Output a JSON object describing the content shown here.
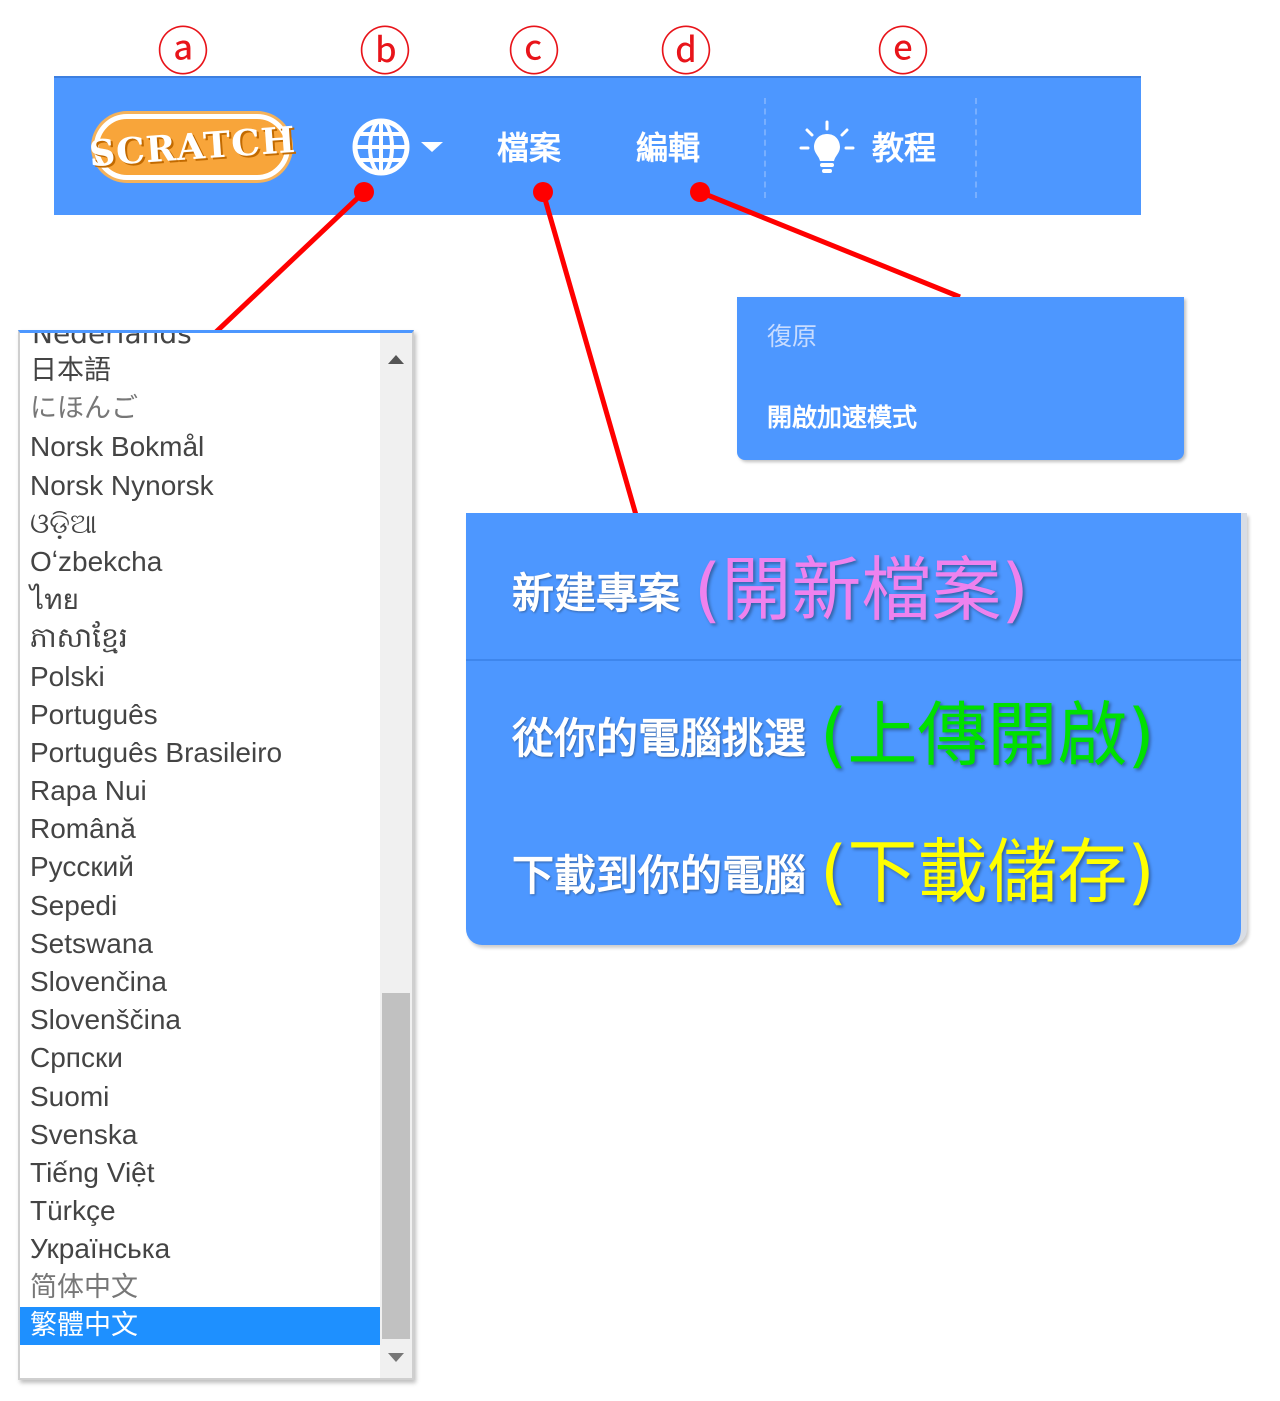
{
  "markers": [
    "ⓐ",
    "ⓑ",
    "ⓒ",
    "ⓓ",
    "ⓔ"
  ],
  "menubar": {
    "logo_text": "SCRATCH",
    "file_label": "檔案",
    "edit_label": "編輯",
    "tutorials_label": "教程",
    "language_icon": "globe-icon",
    "tutorials_icon": "lightbulb-icon"
  },
  "language_menu": {
    "partial_top": "Nederlands",
    "items": [
      "日本語",
      "にほんご",
      "Norsk Bokmål",
      "Norsk Nynorsk",
      "ଓଡ଼ିଆ",
      "Oʻzbekcha",
      "ไทย",
      "ភាសាខ្មែរ",
      "Polski",
      "Português",
      "Português Brasileiro",
      "Rapa Nui",
      "Română",
      "Русский",
      "Sepedi",
      "Setswana",
      "Slovenčina",
      "Slovenščina",
      "Српски",
      "Suomi",
      "Svenska",
      "Tiếng Việt",
      "Türkçe",
      "Українська",
      "简体中文",
      "繁體中文"
    ],
    "selected": "繁體中文"
  },
  "edit_menu": {
    "undo": "復原",
    "turbo_mode": "開啟加速模式"
  },
  "file_menu": {
    "items": [
      {
        "label": "新建專案",
        "note": "(開新檔案)",
        "note_color": "#ee82ee"
      },
      {
        "label": "從你的電腦挑選",
        "note": "(上傳開啟)",
        "note_color": "#00e000"
      },
      {
        "label": "下載到你的電腦",
        "note": "(下載儲存)",
        "note_color": "#ffff00"
      }
    ]
  },
  "colors": {
    "menubar": "#4d97ff",
    "annotation_red": "#ff0000",
    "selected": "#1e90ff"
  }
}
